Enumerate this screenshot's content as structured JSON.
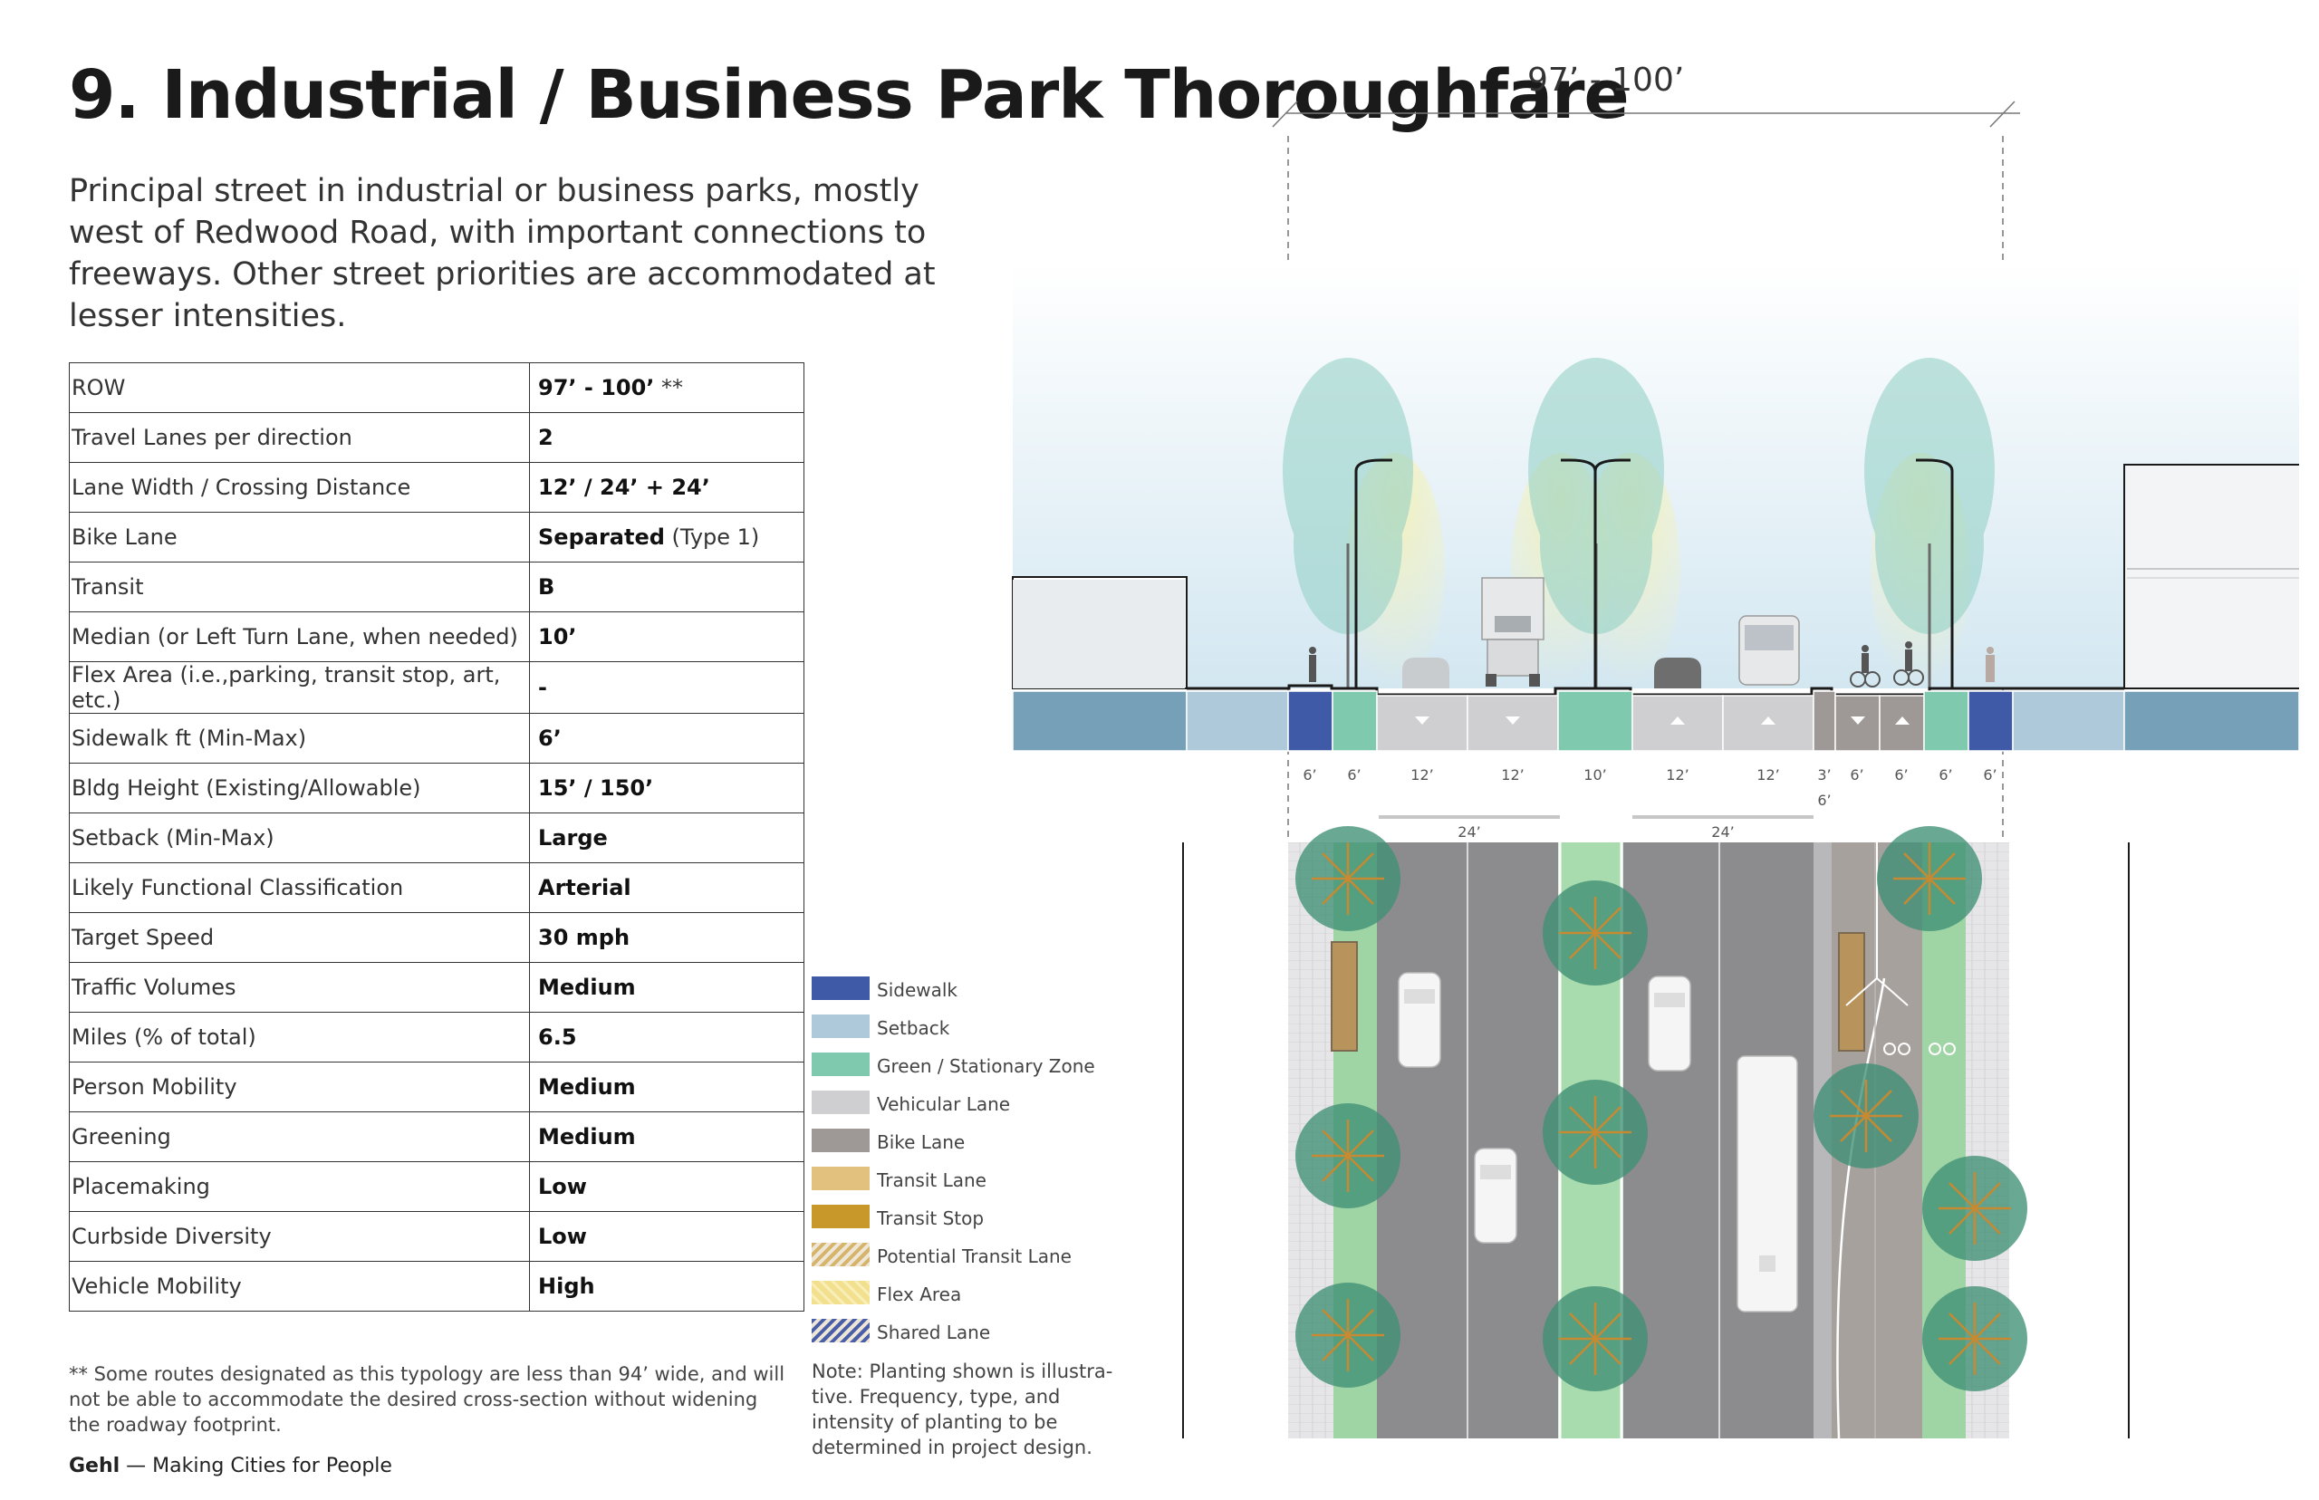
{
  "title": "9. Industrial / Business Park Thoroughfare",
  "description": "Principal street in industrial or business parks, mostly west of Redwood Road, with important connections to freeways. Other street priorities are accommodated at lesser intensities.",
  "table": [
    {
      "label": "ROW",
      "value": "97’ - 100’",
      "suffix": " **"
    },
    {
      "label": "Travel Lanes per direction",
      "value": "2"
    },
    {
      "label": "Lane Width / Crossing Distance",
      "value": "12’ / 24’ + 24’"
    },
    {
      "label": "Bike Lane",
      "value": "Separated",
      "suffix": " (Type 1)"
    },
    {
      "label": "Transit",
      "value": "B"
    },
    {
      "label": "Median (or Left Turn Lane, when needed)",
      "value": "10’"
    },
    {
      "label": "Flex Area (i.e.,parking, transit stop, art, etc.)",
      "value": "-"
    },
    {
      "label": "Sidewalk ft (Min-Max)",
      "value": "6’"
    },
    {
      "label": "Bldg Height (Existing/Allowable)",
      "value": "15’ / 150’"
    },
    {
      "label": "Setback (Min-Max)",
      "value": "Large"
    },
    {
      "label": "Likely Functional Classification",
      "value": "Arterial"
    },
    {
      "label": "Target Speed",
      "value": "30 mph"
    },
    {
      "label": "Traffic Volumes",
      "value": "Medium"
    },
    {
      "label": "Miles (% of total)",
      "value": "6.5"
    },
    {
      "label": "Person Mobility",
      "value": "Medium"
    },
    {
      "label": "Greening",
      "value": "Medium"
    },
    {
      "label": "Placemaking",
      "value": "Low"
    },
    {
      "label": "Curbside Diversity",
      "value": "Low"
    },
    {
      "label": "Vehicle Mobility",
      "value": "High"
    }
  ],
  "footnote": "** Some routes designated as this typology are less than 94’ wide, and will not be able to accommodate the desired cross-section without widening the roadway footprint.",
  "credit": {
    "brand": "Gehl",
    "tagline": " — Making Cities for People"
  },
  "legend": [
    {
      "label": "Sidewalk",
      "color": "#3f5aa6",
      "pattern": "solid"
    },
    {
      "label": "Setback",
      "color": "#aec9da",
      "pattern": "solid"
    },
    {
      "label": "Green / Stationary Zone",
      "color": "#7fcaae",
      "pattern": "solid"
    },
    {
      "label": "Vehicular Lane",
      "color": "#cfcfd1",
      "pattern": "solid"
    },
    {
      "label": "Bike Lane",
      "color": "#9e9896",
      "pattern": "solid"
    },
    {
      "label": "Transit Lane",
      "color": "#e2c07d",
      "pattern": "solid"
    },
    {
      "label": "Transit Stop",
      "color": "#c8982a",
      "pattern": "solid"
    },
    {
      "label": "Potential Transit Lane",
      "color": "#d6b46c",
      "pattern": "hatch"
    },
    {
      "label": "Flex Area",
      "color": "#f2e08f",
      "pattern": "wave"
    },
    {
      "label": "Shared Lane",
      "color": "#4a5fa8",
      "pattern": "hatch"
    }
  ],
  "planting_note": "Note: Planting shown is illustra-tive. Frequency, type, and intensity of planting to be determined in project design.",
  "section": {
    "row_dimension": "97’ - 100’",
    "lane_dims": [
      "6’",
      "6’",
      "12’",
      "12’",
      "10’",
      "12’",
      "12’",
      "3’",
      "6’",
      "6’",
      "6’",
      "6’"
    ],
    "lane_dim_extra": "6’",
    "crossing_dims": [
      "24’",
      "24’"
    ]
  }
}
